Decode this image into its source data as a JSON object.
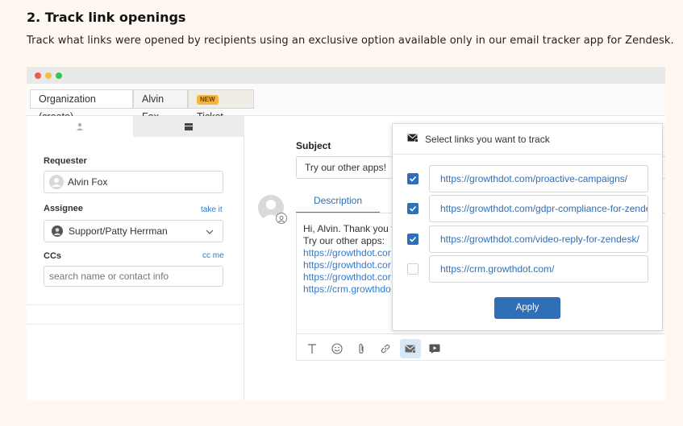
{
  "heading": "2. Track link openings",
  "subtext": "Track what links were opened by recipients using an exclusive option available only in our email tracker app for Zendesk.",
  "tabs": [
    {
      "label": "Organization (create)"
    },
    {
      "label": "Alvin Fox"
    },
    {
      "badge": "NEW",
      "label": "Ticket"
    }
  ],
  "sidebar": {
    "requester_label": "Requester",
    "requester_value": "Alvin Fox",
    "assignee_label": "Assignee",
    "assignee_action": "take it",
    "assignee_value": "Support/Patty Herrman",
    "ccs_label": "CCs",
    "ccs_action": "cc me",
    "ccs_placeholder": "search name or contact info"
  },
  "ticket": {
    "subject_label": "Subject",
    "subject_value": "Try our other apps!",
    "description_tab": "Description",
    "body_lines": [
      "Hi, Alvin. Thank you fo",
      "Try our other apps:",
      "https://growthdot.cor",
      "https://growthdot.cor",
      "https://growthdot.cor",
      "https://crm.growthdo"
    ]
  },
  "popup": {
    "title": "Select links you want to track",
    "links": [
      {
        "url": "https://growthdot.com/proactive-campaigns/",
        "checked": true
      },
      {
        "url": "https://growthdot.com/gdpr-compliance-for-zendesk/",
        "checked": true
      },
      {
        "url": "https://growthdot.com/video-reply-for-zendesk/",
        "checked": true
      },
      {
        "url": "https://crm.growthdot.com/",
        "checked": false
      }
    ],
    "apply_label": "Apply"
  },
  "colors": {
    "accent": "#2f6fb7",
    "link": "#2f7bd0",
    "badge": "#f6b53f",
    "background": "#fff8f1"
  }
}
